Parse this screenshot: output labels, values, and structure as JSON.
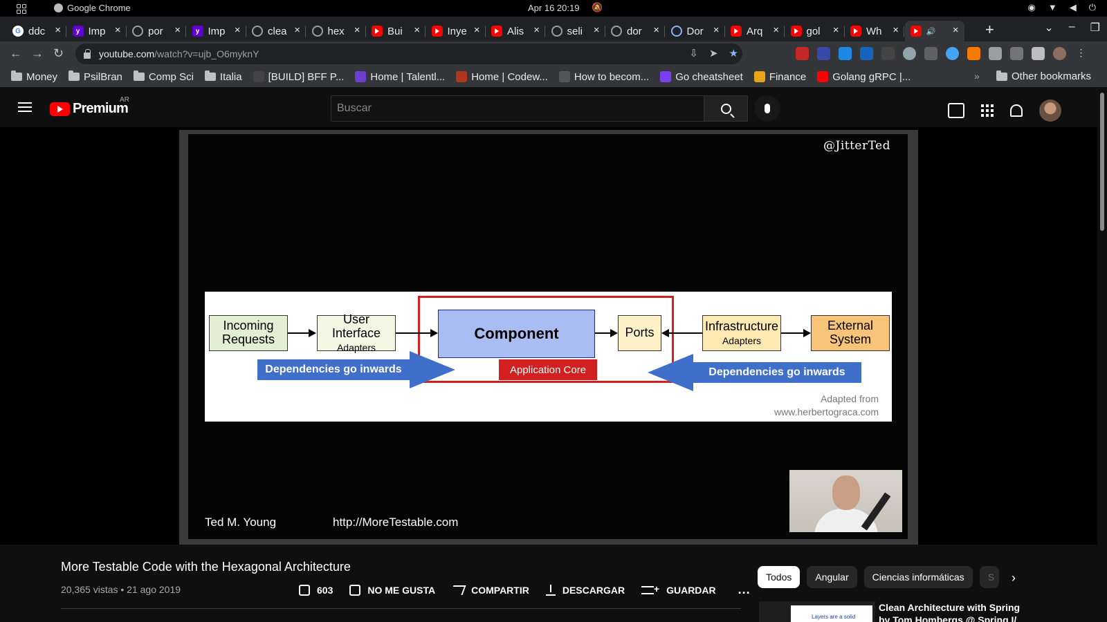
{
  "os": {
    "app_name": "Google Chrome",
    "datetime": "Apr 16  20:19"
  },
  "browser": {
    "tabs": [
      {
        "icon": "google",
        "title": "ddc"
      },
      {
        "icon": "yahoo",
        "title": "Imp"
      },
      {
        "icon": "github",
        "title": "por"
      },
      {
        "icon": "yahoo",
        "title": "Imp"
      },
      {
        "icon": "github",
        "title": "clea"
      },
      {
        "icon": "github",
        "title": "hex"
      },
      {
        "icon": "youtube",
        "title": "Bui"
      },
      {
        "icon": "youtube",
        "title": "Inye"
      },
      {
        "icon": "youtube",
        "title": "Alis"
      },
      {
        "icon": "github",
        "title": "seli"
      },
      {
        "icon": "github",
        "title": "dor"
      },
      {
        "icon": "duckduckgo",
        "title": "Dor"
      },
      {
        "icon": "youtube",
        "title": "Arq"
      },
      {
        "icon": "youtube",
        "title": "gol"
      },
      {
        "icon": "youtube",
        "title": "Wh"
      },
      {
        "icon": "youtube",
        "title": "",
        "active": true
      }
    ],
    "url_host": "youtube.com",
    "url_path": "/watch?v=ujb_O6myknY",
    "bookmarks": [
      {
        "type": "folder",
        "label": "Money"
      },
      {
        "type": "folder",
        "label": "PsilBran"
      },
      {
        "type": "folder",
        "label": "Comp Sci"
      },
      {
        "type": "folder",
        "label": "Italia"
      },
      {
        "type": "site",
        "label": "[BUILD] BFF P...",
        "color": "#444444"
      },
      {
        "type": "site",
        "label": "Home | Talentl...",
        "color": "#6c3fd1"
      },
      {
        "type": "site",
        "label": "Home | Codew...",
        "color": "#b1361e"
      },
      {
        "type": "site",
        "label": "How to becom...",
        "color": "#555555"
      },
      {
        "type": "site",
        "label": "Go cheatsheet",
        "color": "#7b3ff2"
      },
      {
        "type": "site",
        "label": "Finance",
        "color": "#e8a317"
      },
      {
        "type": "site",
        "label": "Golang gRPC |...",
        "color": "#ff0000"
      }
    ],
    "other_bookmarks": "Other bookmarks"
  },
  "youtube": {
    "logo_text": "Premium",
    "region": "AR",
    "search_placeholder": "Buscar"
  },
  "video": {
    "watermark": "@JitterTed",
    "slide": {
      "incoming_main": "Incoming",
      "incoming_sub": "Requests",
      "ui_main": "User Interface",
      "ui_sub": "Adapters",
      "component": "Component",
      "ports": "Ports",
      "infra_main": "Infrastructure",
      "infra_sub": "Adapters",
      "external_main": "External",
      "external_sub": "System",
      "dep_left": "Dependencies go inwards",
      "dep_right": "Dependencies go inwards",
      "core_label": "Application Core",
      "credit_line1": "Adapted from",
      "credit_line2": "www.herbertograca.com"
    },
    "presenter": "Ted M. Young",
    "website": "http://MoreTestable.com",
    "title": "More Testable Code with the Hexagonal Architecture",
    "views_date": "20,365 vistas • 21 ago 2019",
    "likes": "603",
    "dislike_label": "NO ME GUSTA",
    "share_label": "COMPARTIR",
    "download_label": "DESCARGAR",
    "save_label": "GUARDAR",
    "more_label": "..."
  },
  "sidebar": {
    "chips": [
      "Todos",
      "Angular",
      "Ciencias informáticas",
      "S"
    ],
    "recommendation_title": "Clean Architecture with Spring by Tom Hombergs @ Spring I/",
    "recommendation_thumb_text": "Layers are a solid"
  }
}
